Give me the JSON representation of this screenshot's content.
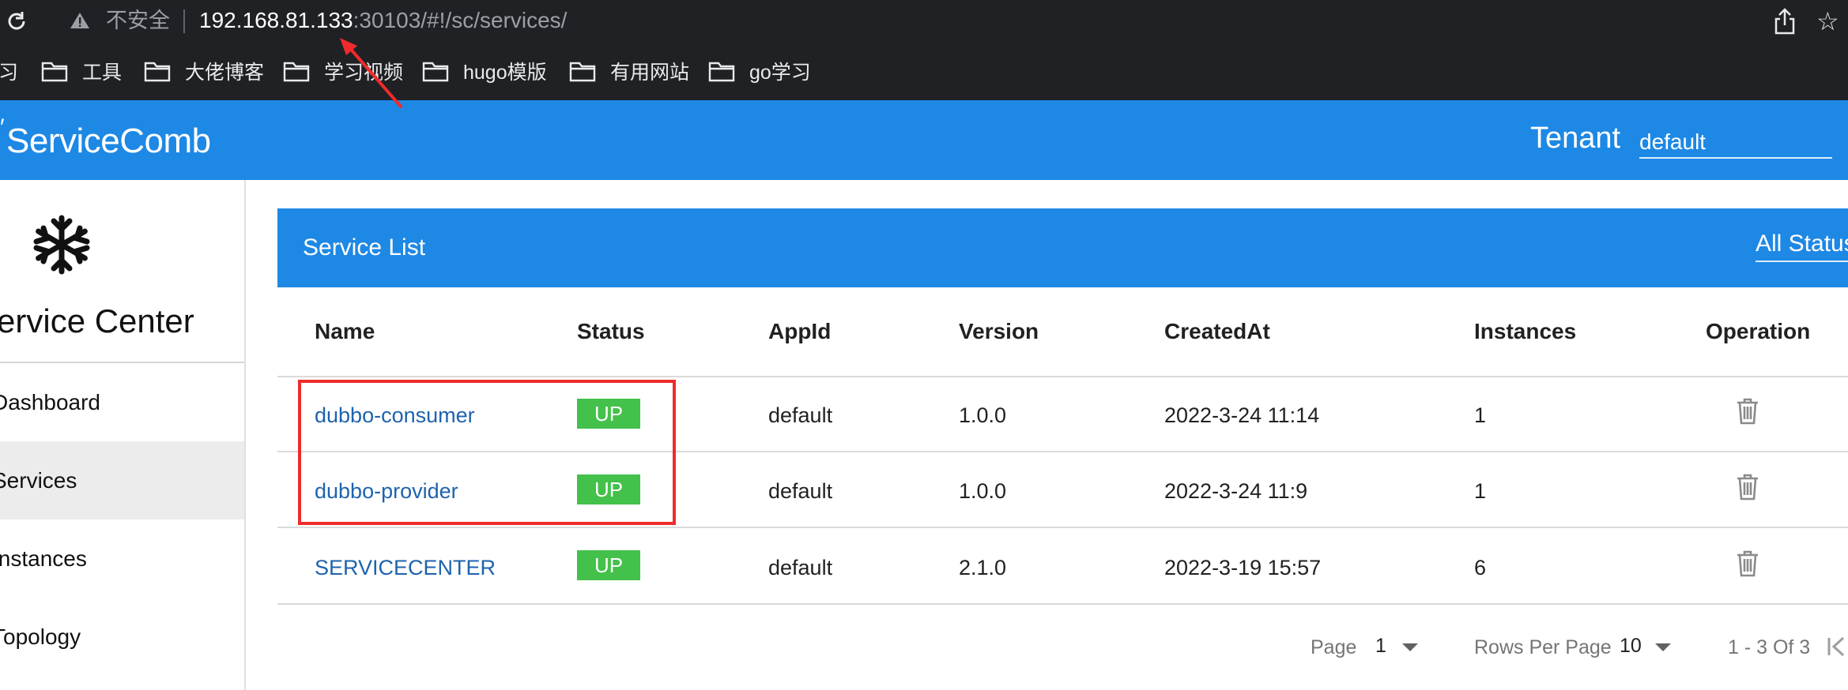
{
  "browser": {
    "security_label": "不安全",
    "url_host": "192.168.81.133",
    "url_rest": ":30103/#!/sc/services/",
    "bookmarks": [
      {
        "label": "习"
      },
      {
        "label": "工具"
      },
      {
        "label": "大佬博客"
      },
      {
        "label": "学习视频"
      },
      {
        "label": "hugo模版"
      },
      {
        "label": "有用网站"
      },
      {
        "label": "go学习"
      }
    ]
  },
  "header": {
    "logo": "ServiceComb",
    "tenant_label": "Tenant",
    "tenant_value": "default"
  },
  "sidebar": {
    "title": "Service Center",
    "items": [
      {
        "label": "Dashboard",
        "active": false
      },
      {
        "label": "Services",
        "active": true
      },
      {
        "label": "Instances",
        "active": false
      },
      {
        "label": "Topology",
        "active": false
      }
    ]
  },
  "service_list": {
    "title": "Service List",
    "status_filter": "All Status",
    "columns": [
      "Name",
      "Status",
      "AppId",
      "Version",
      "CreatedAt",
      "Instances",
      "Operation"
    ],
    "rows": [
      {
        "name": "dubbo-consumer",
        "status": "UP",
        "app_id": "default",
        "version": "1.0.0",
        "created_at": "2022-3-24 11:14",
        "instances": "1"
      },
      {
        "name": "dubbo-provider",
        "status": "UP",
        "app_id": "default",
        "version": "1.0.0",
        "created_at": "2022-3-24 11:9",
        "instances": "1"
      },
      {
        "name": "SERVICECENTER",
        "status": "UP",
        "app_id": "default",
        "version": "2.1.0",
        "created_at": "2022-3-19 15:57",
        "instances": "6"
      }
    ]
  },
  "pagination": {
    "page_label": "Page",
    "page_value": "1",
    "rows_label": "Rows Per Page",
    "rows_value": "10",
    "range_text": "1 - 3 Of 3"
  },
  "colors": {
    "primary": "#1e88e5",
    "status_up": "#43c14a",
    "link": "#1e63ad",
    "annotation": "#ef2b2b"
  }
}
